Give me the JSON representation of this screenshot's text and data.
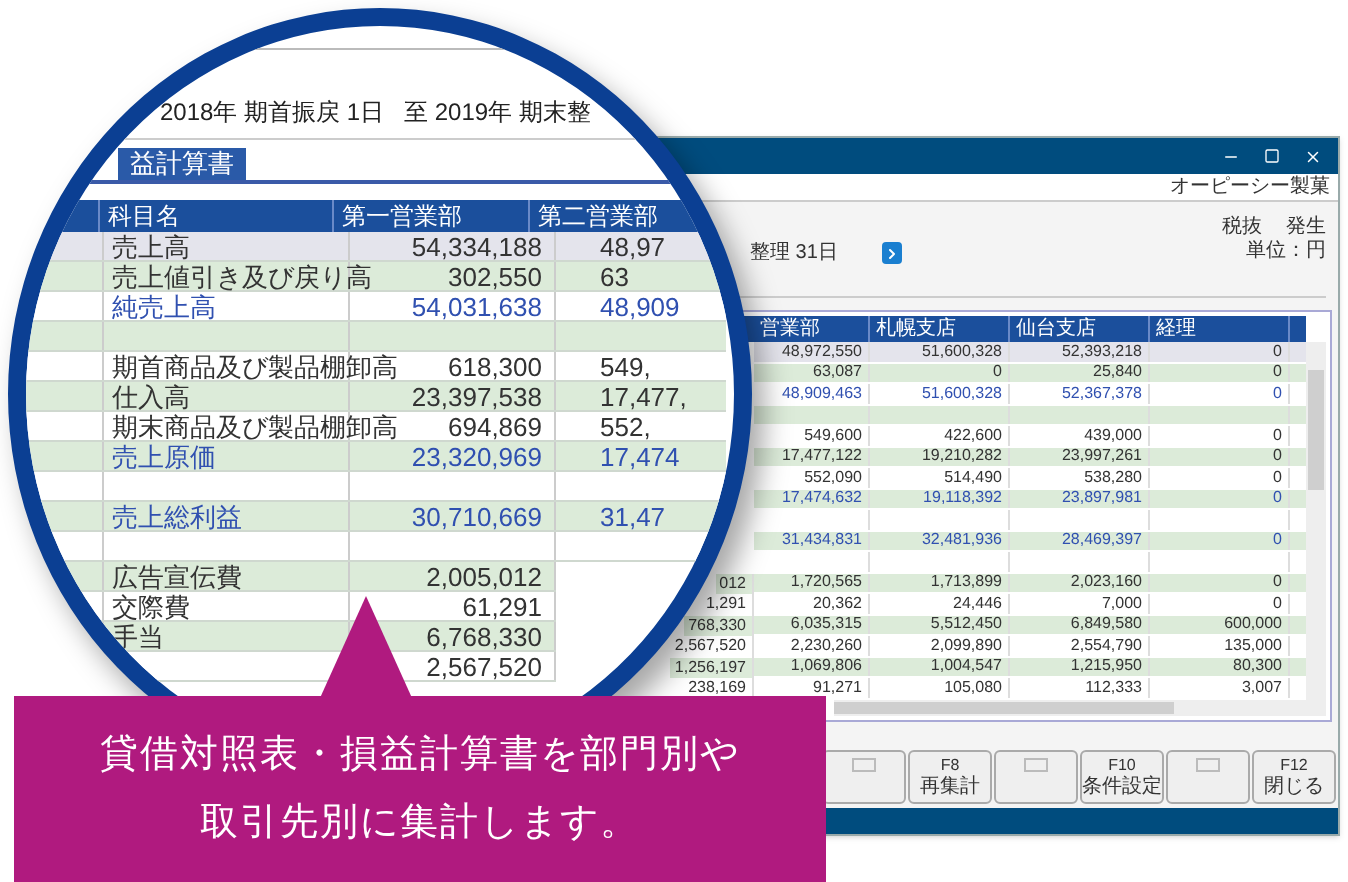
{
  "window": {
    "company": "オーピーシー製菓",
    "period": "整理 31日",
    "tax": "税抜",
    "basis": "発生",
    "unit": "単位：円",
    "table": {
      "columns": [
        "営業部",
        "札幌支店",
        "仙台支店",
        "経理"
      ],
      "rows": [
        {
          "kind": "item",
          "selected": true,
          "cells": [
            "48,972,550",
            "51,600,328",
            "52,393,218",
            "0"
          ]
        },
        {
          "kind": "item",
          "selected": false,
          "cells": [
            "63,087",
            "0",
            "25,840",
            "0"
          ]
        },
        {
          "kind": "total",
          "selected": false,
          "cells": [
            "48,909,463",
            "51,600,328",
            "52,367,378",
            "0"
          ]
        },
        {
          "kind": "blank",
          "selected": false
        },
        {
          "kind": "item",
          "selected": false,
          "cells": [
            "549,600",
            "422,600",
            "439,000",
            "0"
          ]
        },
        {
          "kind": "item",
          "selected": false,
          "cells": [
            "17,477,122",
            "19,210,282",
            "23,997,261",
            "0"
          ]
        },
        {
          "kind": "item",
          "selected": false,
          "cells": [
            "552,090",
            "514,490",
            "538,280",
            "0"
          ]
        },
        {
          "kind": "total",
          "selected": false,
          "cells": [
            "17,474,632",
            "19,118,392",
            "23,897,981",
            "0"
          ]
        },
        {
          "kind": "blank",
          "selected": false
        },
        {
          "kind": "total",
          "selected": false,
          "cells": [
            "31,434,831",
            "32,481,936",
            "28,469,397",
            "0"
          ]
        },
        {
          "kind": "blank",
          "selected": false
        },
        {
          "kind": "item",
          "selected": false,
          "lead": "012",
          "cells": [
            "1,720,565",
            "1,713,899",
            "2,023,160",
            "0"
          ]
        },
        {
          "kind": "item",
          "selected": false,
          "lead": "1,291",
          "cells": [
            "20,362",
            "24,446",
            "7,000",
            "0"
          ]
        },
        {
          "kind": "item",
          "selected": false,
          "lead": "768,330",
          "cells": [
            "6,035,315",
            "5,512,450",
            "6,849,580",
            "600,000"
          ]
        },
        {
          "kind": "item",
          "selected": false,
          "lead": "2,567,520",
          "cells": [
            "2,230,260",
            "2,099,890",
            "2,554,790",
            "135,000"
          ]
        },
        {
          "kind": "item",
          "selected": false,
          "lead": "1,256,197",
          "cells": [
            "1,069,806",
            "1,004,547",
            "1,215,950",
            "80,300"
          ]
        },
        {
          "kind": "item",
          "selected": false,
          "lead": "238,169",
          "cells": [
            "91,271",
            "105,080",
            "112,333",
            "3,007"
          ]
        }
      ]
    },
    "function_keys": [
      {
        "kind": "blank"
      },
      {
        "kind": "key",
        "key": "F8",
        "label": "再集計"
      },
      {
        "kind": "blank"
      },
      {
        "kind": "key",
        "key": "F10",
        "label": "条件設定"
      },
      {
        "kind": "blank"
      },
      {
        "kind": "key",
        "key": "F12",
        "label": "閉じる"
      }
    ]
  },
  "magnifier": {
    "period_from": "2018年 期首振戻 1日",
    "period_to": "至 2019年 期末整",
    "tab": {
      "label": "益計算書",
      "selected": true
    },
    "columns": [
      "科目名",
      "第一営業部",
      "第二営業部"
    ],
    "rows": [
      {
        "kind": "item",
        "selected": true,
        "name": "売上高",
        "cells": [
          "54,334,188",
          "48,97"
        ]
      },
      {
        "kind": "item",
        "selected": false,
        "name": "売上値引き及び戻り高",
        "cells": [
          "302,550",
          "63"
        ]
      },
      {
        "kind": "total",
        "selected": false,
        "name": "純売上高",
        "cells": [
          "54,031,638",
          "48,909"
        ]
      },
      {
        "kind": "blank",
        "selected": false
      },
      {
        "kind": "item",
        "selected": false,
        "name": "期首商品及び製品棚卸高",
        "cells": [
          "618,300",
          "549,"
        ]
      },
      {
        "kind": "item",
        "selected": false,
        "name": "仕入高",
        "cells": [
          "23,397,538",
          "17,477,"
        ]
      },
      {
        "kind": "item",
        "selected": false,
        "name": "期末商品及び製品棚卸高",
        "cells": [
          "694,869",
          "552,"
        ]
      },
      {
        "kind": "total",
        "selected": false,
        "name": "売上原価",
        "cells": [
          "23,320,969",
          "17,474"
        ]
      },
      {
        "kind": "blank",
        "selected": false
      },
      {
        "kind": "total",
        "selected": false,
        "name": "売上総利益",
        "cells": [
          "30,710,669",
          "31,47"
        ]
      },
      {
        "kind": "blank",
        "selected": false
      },
      {
        "kind": "item",
        "selected": false,
        "name": "広告宣伝費",
        "cells": [
          "2,005,012"
        ]
      },
      {
        "kind": "item",
        "selected": false,
        "name": "交際費",
        "cells": [
          "61,291"
        ]
      },
      {
        "kind": "item",
        "selected": false,
        "name": "手当",
        "cells": [
          "6,768,330"
        ]
      },
      {
        "kind": "item",
        "selected": false,
        "cells": [
          "2,567,520"
        ]
      }
    ]
  },
  "callout": {
    "text": "貸借対照表・損益計算書を部門別や取引先別に集計します。"
  }
}
